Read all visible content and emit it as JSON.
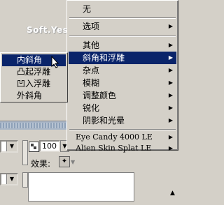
{
  "watermark": "Soft.Yesky.c●m",
  "menu": {
    "items": [
      {
        "label": "无",
        "has_submenu": false
      },
      {
        "label": "选项",
        "has_submenu": true
      },
      {
        "label": "其他",
        "has_submenu": true
      },
      {
        "label": "斜角和浮雕",
        "has_submenu": true,
        "highlighted": true
      },
      {
        "label": "杂点",
        "has_submenu": true
      },
      {
        "label": "模糊",
        "has_submenu": true
      },
      {
        "label": "调整颜色",
        "has_submenu": true
      },
      {
        "label": "锐化",
        "has_submenu": true
      },
      {
        "label": "阴影和光晕",
        "has_submenu": true
      },
      {
        "label": "Eye Candy 4000 LE",
        "has_submenu": true
      },
      {
        "label": "Alien Skin Splat LE",
        "has_submenu": true
      }
    ],
    "arrow": "▶"
  },
  "submenu": {
    "items": [
      {
        "label": "内斜角",
        "highlighted": true
      },
      {
        "label": "凸起浮雕"
      },
      {
        "label": "凹入浮雕"
      },
      {
        "label": "外斜角"
      }
    ]
  },
  "panel": {
    "opacity_value": "100",
    "effect_label": "效果:",
    "combo_arrow": "▼",
    "corner_arrow": "▲"
  },
  "colors": {
    "face": "#d4d0c8",
    "highlight": "#0a246a",
    "highlight_text": "#ffffff"
  },
  "icons": {
    "submenu_arrow": "triangle-right-icon",
    "cursor": "mouse-pointer-icon",
    "effect": "fx-icon",
    "opacity": "checker-icon"
  }
}
